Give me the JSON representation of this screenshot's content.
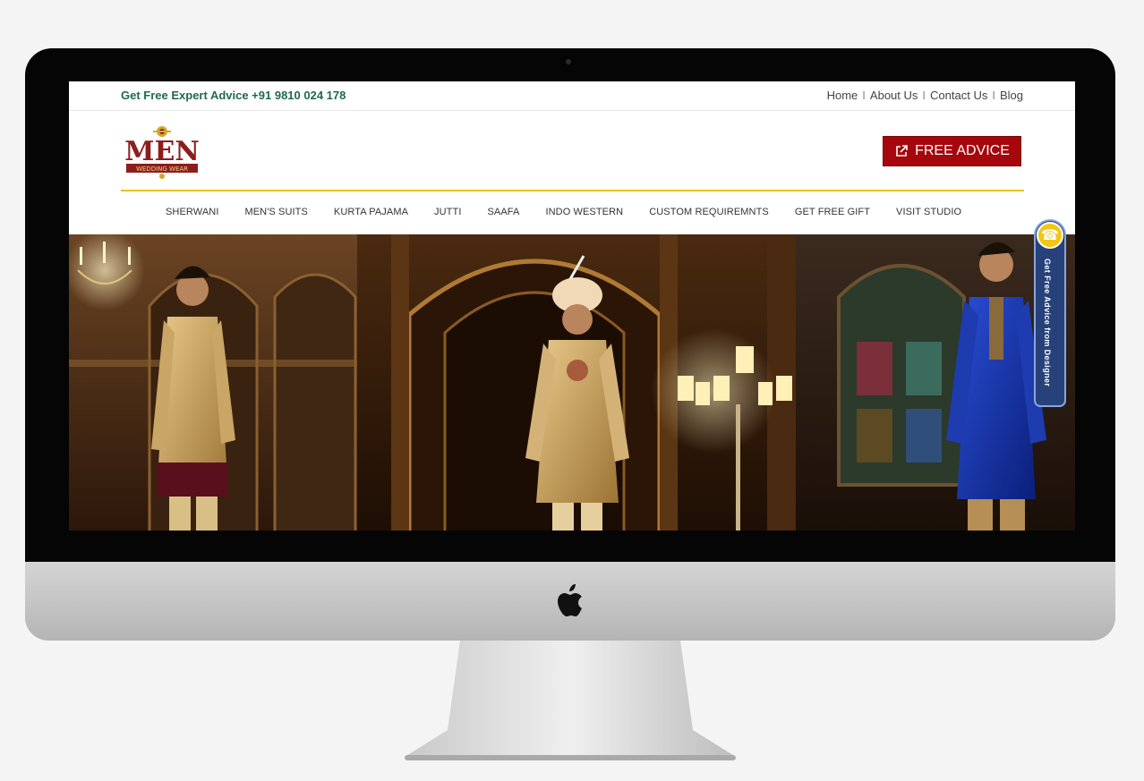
{
  "header": {
    "advice_line": "Get Free Expert Advice +91 9810 024 178",
    "links": [
      "Home",
      "About Us",
      "Contact Us",
      "Blog"
    ],
    "link_separator": "I",
    "cta": {
      "label": "FREE ADVICE",
      "icon": "external-link-icon",
      "color": "#a5070c"
    }
  },
  "logo": {
    "text": "MEN",
    "subtext": "WEDDING WEAR"
  },
  "nav": {
    "items": [
      "SHERWANI",
      "MEN'S SUITS",
      "KURTA PAJAMA",
      "JUTTI",
      "SAAFA",
      "INDO WESTERN",
      "CUSTOM REQUIREMNTS",
      "GET FREE GIFT",
      "VISIT STUDIO"
    ]
  },
  "side_tab": {
    "label": "Get Free Advice from Designer",
    "icon": "phone-icon",
    "color": "#27427b"
  },
  "colors": {
    "accent_gold": "#e9c21b",
    "advice_green": "#1f6a4a"
  }
}
